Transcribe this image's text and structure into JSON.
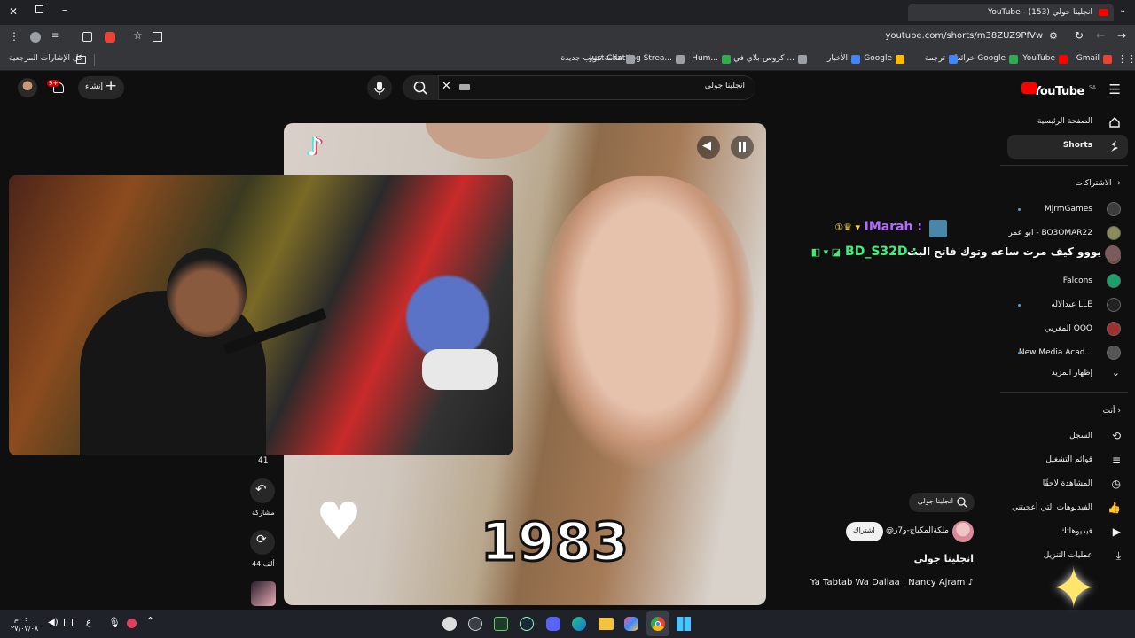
{
  "browser": {
    "tab_title": "YouTube - انجلينا جولي (153)",
    "url": "youtube.com/shorts/m38ZUZ9PfVw",
    "bookmarks": [
      {
        "label": "Gmail",
        "color": "#ea4335"
      },
      {
        "label": "YouTube",
        "color": "#ff0000"
      },
      {
        "label": "خرائط Google",
        "color": "#34a853"
      },
      {
        "label": "ترجمة",
        "color": "#4285f4"
      },
      {
        "label": "Google",
        "color": "#fbbc05"
      },
      {
        "label": "الأخبار",
        "color": "#4285f4"
      },
      {
        "label": "كروس-بلاي في ...",
        "color": "#9aa0a6"
      },
      {
        "label": "Hum...",
        "color": "#34a853"
      },
      {
        "label": "Just Chatting Strea...",
        "color": "#9aa0a6"
      },
      {
        "label": "علامة تبويب جديدة",
        "color": "#9aa0a6"
      }
    ],
    "all_bookmarks": "كل الإشارات المرجعية"
  },
  "header": {
    "logo": "YouTube",
    "logo_region": "SA",
    "search_value": "انجلينا جولي",
    "create_label": "إنشاء",
    "notif_count": "9+"
  },
  "sidebar": {
    "home": "الصفحة الرئيسية",
    "shorts": "Shorts",
    "subscriptions_title": "الاشتراكات",
    "subs": [
      {
        "label": "MjrmGames",
        "dot": true,
        "color": "#3d3d3d"
      },
      {
        "label": "ابو عمر - BO3OMAR22",
        "dot": false,
        "color": "#8a8a5a"
      },
      {
        "label": "",
        "dot": false,
        "color": "#6b4a3a"
      },
      {
        "label": "Falcons",
        "dot": false,
        "color": "#1aa06a"
      },
      {
        "label": "عبدالاله LLE",
        "dot": true,
        "color": "#222"
      },
      {
        "label": "المغربي QQQ",
        "dot": false,
        "color": "#a03030"
      },
      {
        "label": "New Media Acad...",
        "dot": true,
        "color": "#555"
      }
    ],
    "show_more": "إظهار المزيد",
    "you_title": "أنت",
    "you_items": [
      "السجل",
      "قوائم التشغيل",
      "المشاهدة لاحقًا",
      "الفيديوهات التي أعجبتني",
      "فيديوهاتك",
      "عمليات التنزيل"
    ]
  },
  "overlay_chat": {
    "line1_user": "IMarah",
    "line1_sep": ":",
    "line2_user": "BD_S32D",
    "line2_msg": "يووو كيف مرت ساعه وتوك فاتح البث"
  },
  "short": {
    "search_chip": "انجلينا جولي",
    "channel": "@ملكةالمكياج-و7ز",
    "subscribe": "اشتراك",
    "title": "انجلينا جولي",
    "music": "Ya Tabtab Wa Dallaa · Nancy Ajram",
    "year_overlay": "1983",
    "comment_count": "41",
    "share": "مشاركة",
    "remix_count": "44 ألف",
    "sidebar_tag": "انجلينا جولي"
  },
  "taskbar": {
    "time": "٠:٠٠ م",
    "date": "٢٧/٠٧/٠٨",
    "lang": "ع"
  }
}
